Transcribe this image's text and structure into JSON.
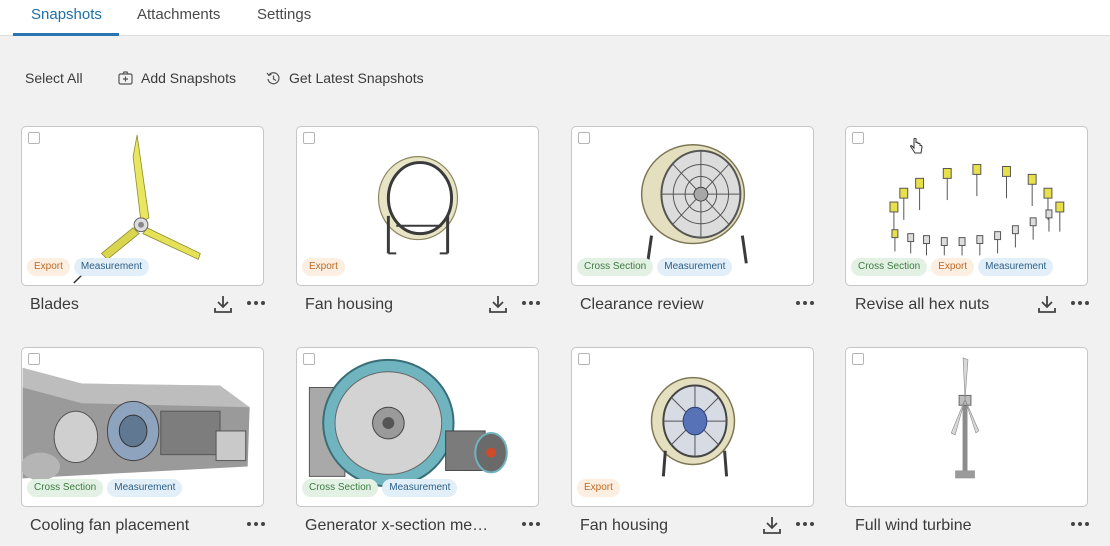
{
  "tabs": [
    {
      "label": "Snapshots",
      "active": true
    },
    {
      "label": "Attachments",
      "active": false
    },
    {
      "label": "Settings",
      "active": false
    }
  ],
  "toolbar": {
    "select_all": "Select All",
    "add_snapshots": "Add Snapshots",
    "get_latest": "Get Latest Snapshots"
  },
  "tag_colors": {
    "export": "#bf6a25",
    "measurement": "#2c5f86",
    "cross_section": "#3d7a41"
  },
  "cards": [
    {
      "title": "Blades",
      "tags": [
        "Export",
        "Measurement"
      ],
      "download": true,
      "icon": "blades-thumbnail"
    },
    {
      "title": "Fan housing",
      "tags": [
        "Export"
      ],
      "download": true,
      "icon": "fan-housing-thumbnail"
    },
    {
      "title": "Clearance review",
      "tags": [
        "Cross Section",
        "Measurement"
      ],
      "download": false,
      "icon": "fan-thumbnail"
    },
    {
      "title": "Revise all hex nuts",
      "tags": [
        "Cross Section",
        "Export",
        "Measurement"
      ],
      "download": true,
      "icon": "hex-nuts-thumbnail"
    },
    {
      "title": "Cooling fan placement",
      "tags": [
        "Cross Section",
        "Measurement"
      ],
      "download": false,
      "icon": "machinery-thumbnail"
    },
    {
      "title": "Generator x-section me…",
      "tags": [
        "Cross Section",
        "Measurement"
      ],
      "download": false,
      "icon": "generator-thumbnail"
    },
    {
      "title": "Fan housing",
      "tags": [
        "Export"
      ],
      "download": true,
      "icon": "fan-thumbnail"
    },
    {
      "title": "Full wind turbine",
      "tags": [],
      "download": false,
      "icon": "wind-turbine-thumbnail"
    }
  ]
}
